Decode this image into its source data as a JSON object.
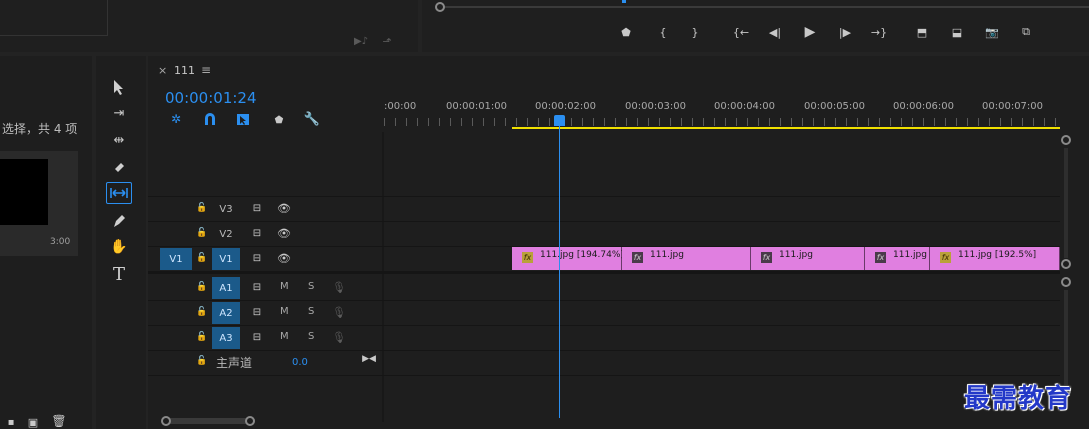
{
  "project": {
    "selection_text": "选择，共 4 项",
    "thumb_duration": "3:00"
  },
  "program_monitor": {
    "controls": [
      {
        "name": "add-marker-icon",
        "glyph": "⬟"
      },
      {
        "name": "mark-in-icon",
        "glyph": "{"
      },
      {
        "name": "mark-out-icon",
        "glyph": "}"
      },
      {
        "name": "go-to-in-icon",
        "glyph": "{←"
      },
      {
        "name": "step-back-icon",
        "glyph": "◀|"
      },
      {
        "name": "play-icon",
        "glyph": "▶"
      },
      {
        "name": "step-forward-icon",
        "glyph": "|▶"
      },
      {
        "name": "go-to-out-icon",
        "glyph": "→}"
      },
      {
        "name": "lift-icon",
        "glyph": "⬒"
      },
      {
        "name": "extract-icon",
        "glyph": "⬓"
      },
      {
        "name": "export-frame-icon",
        "glyph": "📷"
      },
      {
        "name": "comparison-view-icon",
        "glyph": "⧉"
      }
    ]
  },
  "timeline": {
    "tab_close": "×",
    "tab_name": "111",
    "tab_menu": "≡",
    "timecode": "00:00:01:24",
    "ruler": [
      ":00:00",
      "00:00:01:00",
      "00:00:02:00",
      "00:00:03:00",
      "00:00:04:00",
      "00:00:05:00",
      "00:00:06:00",
      "00:00:07:00"
    ],
    "video_tracks": [
      {
        "label": "V3",
        "source": "",
        "active": false
      },
      {
        "label": "V2",
        "source": "",
        "active": false
      },
      {
        "label": "V1",
        "source": "V1",
        "active": true
      }
    ],
    "audio_tracks": [
      {
        "label": "A1",
        "m": "M",
        "s": "S"
      },
      {
        "label": "A2",
        "m": "M",
        "s": "S"
      },
      {
        "label": "A3",
        "m": "M",
        "s": "S"
      }
    ],
    "master": {
      "label": "主声道",
      "value": "0.0"
    },
    "clips": [
      {
        "label": "111.jpg [194.74%]",
        "fx_active": true
      },
      {
        "label": "111.jpg",
        "fx_active": false
      },
      {
        "label": "111.jpg",
        "fx_active": false
      },
      {
        "label": "111.jpg",
        "fx_active": false
      },
      {
        "label": "111.jpg [192.5%]",
        "fx_active": true
      }
    ],
    "fx_label": "fx"
  },
  "watermark": "最需教育",
  "colors": {
    "accent_blue": "#2b8ff0",
    "clip_pink": "#e07fe0",
    "work_area_yellow": "#f0e000"
  }
}
